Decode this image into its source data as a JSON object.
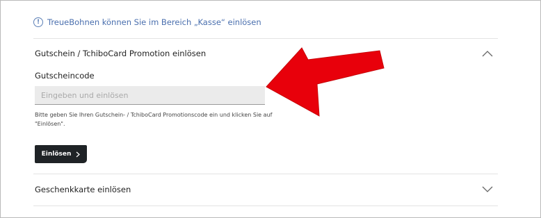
{
  "info": {
    "icon": "info-icon",
    "text": "TreueBohnen können Sie im Bereich „Kasse“ einlösen"
  },
  "voucher_section": {
    "title": "Gutschein / TchiboCard Promotion einlösen",
    "expanded": true,
    "chevron_icon": "chevron-up-icon",
    "field_label": "Gutscheincode",
    "input_value": "",
    "input_placeholder": "Eingeben und einlösen",
    "help_text": "Bitte geben Sie Ihren Gutschein- / TchiboCard Promotionscode ein und klicken Sie auf \"Einlösen\".",
    "button_label": "Einlösen",
    "button_icon": "chevron-right-icon"
  },
  "gift_card_section": {
    "title": "Geschenkkarte einlösen",
    "expanded": false,
    "chevron_icon": "chevron-down-icon"
  },
  "annotation": {
    "icon": "red-arrow-icon",
    "color": "#e8000b"
  },
  "colors": {
    "info_blue": "#4a6fae",
    "button_dark": "#1f2326",
    "input_bg": "#ebebeb",
    "divider": "#e3e3e3"
  }
}
